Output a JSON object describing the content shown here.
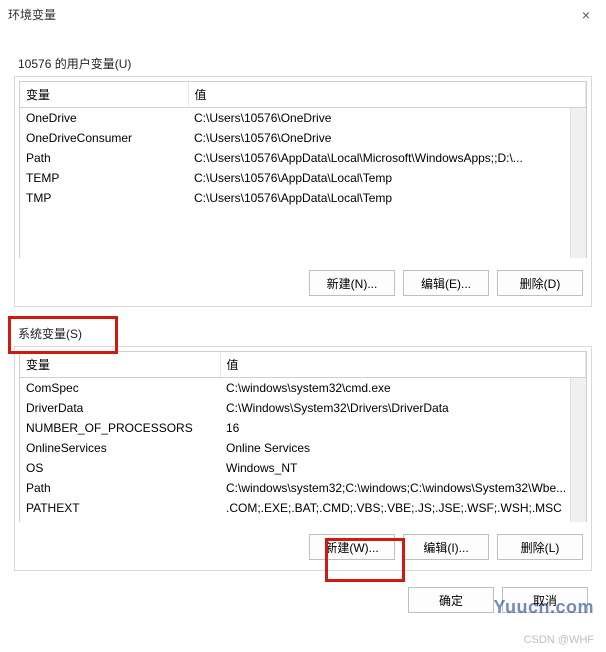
{
  "window": {
    "title": "环境变量",
    "close_glyph": "×"
  },
  "user_vars": {
    "label": "10576 的用户变量(U)",
    "header_variable": "变量",
    "header_value": "值",
    "rows": [
      {
        "name": "OneDrive",
        "value": "C:\\Users\\10576\\OneDrive"
      },
      {
        "name": "OneDriveConsumer",
        "value": "C:\\Users\\10576\\OneDrive"
      },
      {
        "name": "Path",
        "value": "C:\\Users\\10576\\AppData\\Local\\Microsoft\\WindowsApps;;D:\\..."
      },
      {
        "name": "TEMP",
        "value": "C:\\Users\\10576\\AppData\\Local\\Temp"
      },
      {
        "name": "TMP",
        "value": "C:\\Users\\10576\\AppData\\Local\\Temp"
      }
    ],
    "buttons": {
      "new": "新建(N)...",
      "edit": "编辑(E)...",
      "delete": "删除(D)"
    }
  },
  "sys_vars": {
    "label": "系统变量(S)",
    "header_variable": "变量",
    "header_value": "值",
    "rows": [
      {
        "name": "ComSpec",
        "value": "C:\\windows\\system32\\cmd.exe"
      },
      {
        "name": "DriverData",
        "value": "C:\\Windows\\System32\\Drivers\\DriverData"
      },
      {
        "name": "NUMBER_OF_PROCESSORS",
        "value": "16"
      },
      {
        "name": "OnlineServices",
        "value": "Online Services"
      },
      {
        "name": "OS",
        "value": "Windows_NT"
      },
      {
        "name": "Path",
        "value": "C:\\windows\\system32;C:\\windows;C:\\windows\\System32\\Wbe..."
      },
      {
        "name": "PATHEXT",
        "value": ".COM;.EXE;.BAT;.CMD;.VBS;.VBE;.JS;.JSE;.WSF;.WSH;.MSC"
      }
    ],
    "buttons": {
      "new": "新建(W)...",
      "edit": "编辑(I)...",
      "delete": "删除(L)"
    }
  },
  "footer": {
    "ok": "确定",
    "cancel": "取消"
  },
  "watermark": "Yuucn.com",
  "csdn": "CSDN @WHF"
}
